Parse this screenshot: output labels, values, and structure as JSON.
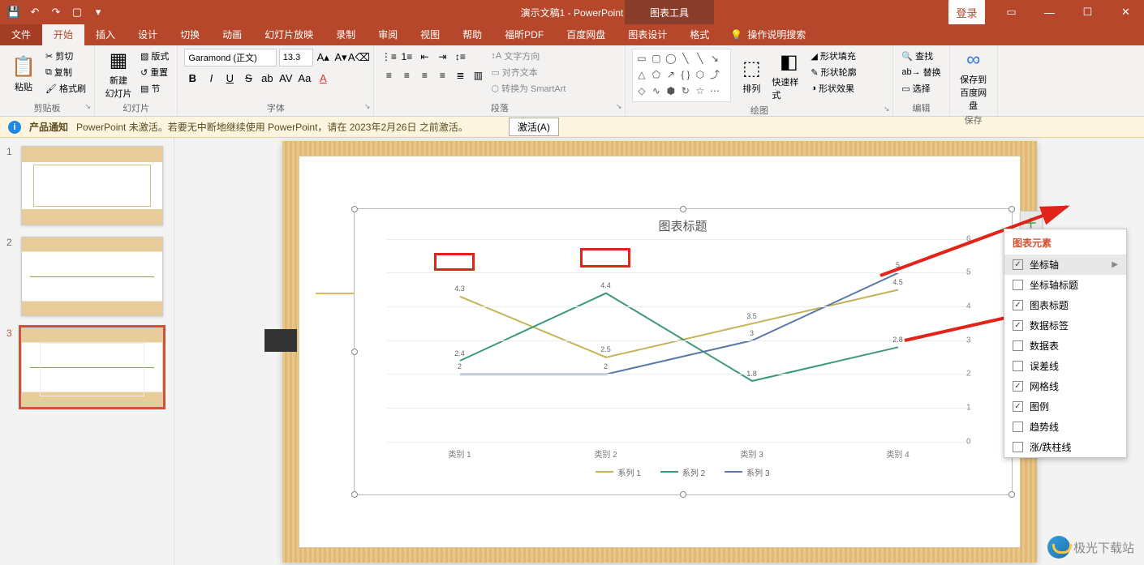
{
  "titlebar": {
    "title": "演示文稿1 - PowerPoint",
    "context_tab": "图表工具",
    "login": "登录"
  },
  "tabs": {
    "file": "文件",
    "home": "开始",
    "insert": "插入",
    "design": "设计",
    "transitions": "切换",
    "animations": "动画",
    "slideshow": "幻灯片放映",
    "record": "录制",
    "review": "审阅",
    "view": "视图",
    "help": "帮助",
    "foxit": "福昕PDF",
    "baidu": "百度网盘",
    "chart_design": "图表设计",
    "format": "格式",
    "tellme": "操作说明搜索"
  },
  "ribbon": {
    "clipboard": {
      "label": "剪贴板",
      "paste": "粘贴",
      "cut": "剪切",
      "copy": "复制",
      "format_painter": "格式刷"
    },
    "slides": {
      "label": "幻灯片",
      "new_slide": "新建\n幻灯片",
      "layout": "版式",
      "reset": "重置",
      "section": "节"
    },
    "font": {
      "label": "字体",
      "name": "Garamond (正文)",
      "size": "13.3"
    },
    "paragraph": {
      "label": "段落",
      "text_dir": "文字方向",
      "align_text": "对齐文本",
      "smartart": "转换为 SmartArt"
    },
    "drawing": {
      "label": "绘图",
      "arrange": "排列",
      "quick_styles": "快速样式",
      "fill": "形状填充",
      "outline": "形状轮廓",
      "effects": "形状效果"
    },
    "editing": {
      "label": "编辑",
      "find": "查找",
      "replace": "替换",
      "select": "选择"
    },
    "save": {
      "label": "保存",
      "save_to": "保存到\n百度网盘"
    }
  },
  "notice": {
    "title": "产品通知",
    "text": "PowerPoint 未激活。若要无中断地继续使用 PowerPoint，请在 2023年2月26日 之前激活。",
    "activate": "激活(A)"
  },
  "thumbnails": [
    {
      "n": "1"
    },
    {
      "n": "2"
    },
    {
      "n": "3"
    }
  ],
  "chart_elements": {
    "title": "图表元素",
    "items": [
      {
        "label": "坐标轴",
        "checked": true,
        "hov": true,
        "arrow": true
      },
      {
        "label": "坐标轴标题",
        "checked": false
      },
      {
        "label": "图表标题",
        "checked": true
      },
      {
        "label": "数据标签",
        "checked": true
      },
      {
        "label": "数据表",
        "checked": false
      },
      {
        "label": "误差线",
        "checked": false
      },
      {
        "label": "网格线",
        "checked": true
      },
      {
        "label": "图例",
        "checked": true
      },
      {
        "label": "趋势线",
        "checked": false
      },
      {
        "label": "涨/跌柱线",
        "checked": false
      }
    ]
  },
  "watermark": "极光下载站",
  "chart_data": {
    "type": "line",
    "title": "图表标题",
    "categories": [
      "类别 1",
      "类别 2",
      "类别 3",
      "类别 4"
    ],
    "series": [
      {
        "name": "系列 1",
        "color": "#c5b358",
        "values": [
          4.3,
          2.5,
          3.5,
          4.5
        ]
      },
      {
        "name": "系列 2",
        "color": "#3b9a74",
        "values": [
          2.4,
          4.4,
          1.8,
          2.8
        ]
      },
      {
        "name": "系列 3",
        "color": "#5b7aa8",
        "values": [
          2,
          2,
          3,
          5
        ]
      }
    ],
    "yticks": [
      0,
      1,
      2,
      3,
      4,
      5,
      6
    ],
    "ylim": [
      0,
      6
    ],
    "legend_position": "bottom",
    "data_labels": [
      {
        "s": 0,
        "i": 0,
        "v": "4.3"
      },
      {
        "s": 0,
        "i": 1,
        "v": "2.5"
      },
      {
        "s": 0,
        "i": 2,
        "v": "3.5"
      },
      {
        "s": 0,
        "i": 3,
        "v": "4.5"
      },
      {
        "s": 1,
        "i": 0,
        "v": "2.4"
      },
      {
        "s": 1,
        "i": 1,
        "v": "4.4"
      },
      {
        "s": 1,
        "i": 2,
        "v": "1.8"
      },
      {
        "s": 1,
        "i": 3,
        "v": "2.8"
      },
      {
        "s": 2,
        "i": 0,
        "v": "2"
      },
      {
        "s": 2,
        "i": 1,
        "v": "2"
      },
      {
        "s": 2,
        "i": 2,
        "v": "3"
      },
      {
        "s": 2,
        "i": 3,
        "v": "5"
      }
    ]
  }
}
